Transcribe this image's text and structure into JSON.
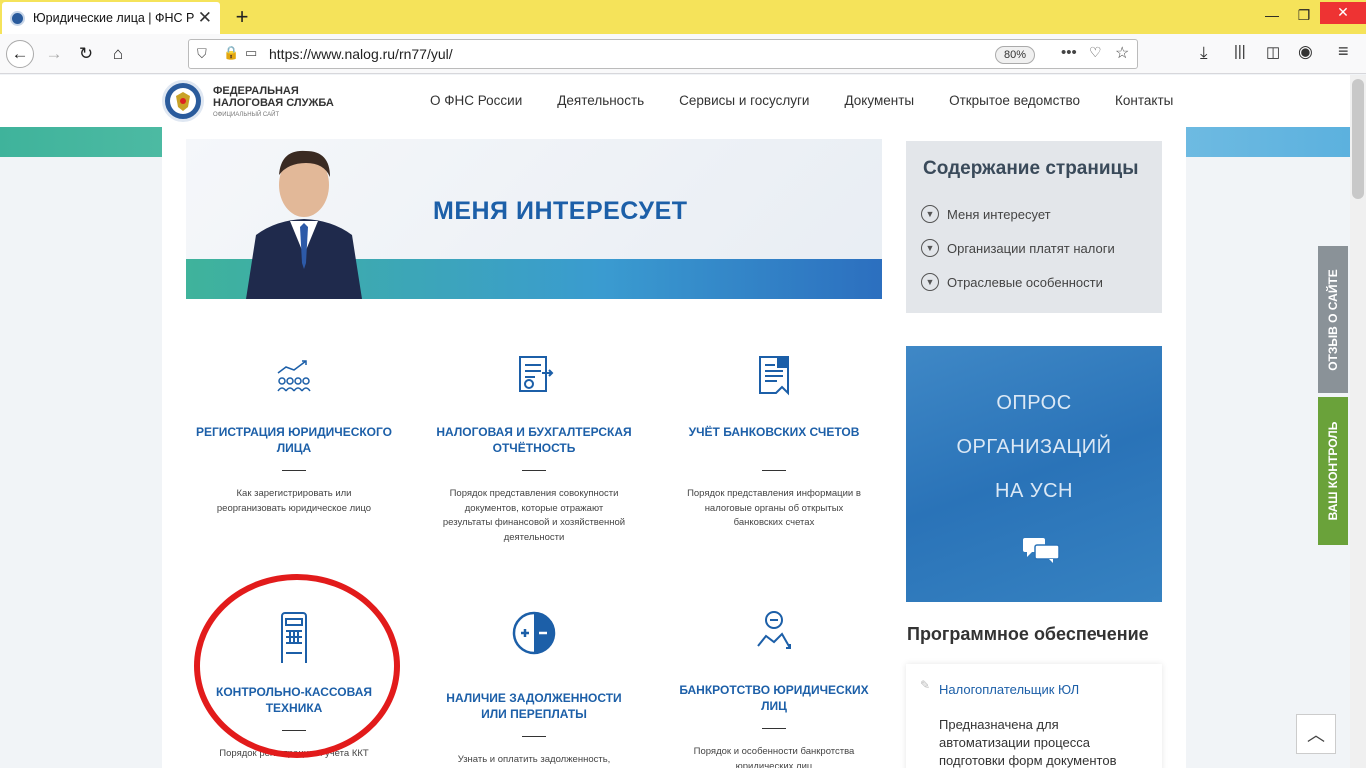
{
  "browser": {
    "tab_title": "Юридические лица | ФНС Рос",
    "url": "https://www.nalog.ru/rn77/yul/",
    "zoom": "80%"
  },
  "site": {
    "logo_line1": "ФЕДЕРАЛЬНАЯ",
    "logo_line2": "НАЛОГОВАЯ СЛУЖБА",
    "logo_sub": "ОФИЦИАЛЬНЫЙ САЙТ",
    "menu": [
      "О ФНС России",
      "Деятельность",
      "Сервисы и госуслуги",
      "Документы",
      "Открытое ведомство",
      "Контакты"
    ]
  },
  "hero": {
    "title": "МЕНЯ ИНТЕРЕСУЕТ"
  },
  "toc": {
    "title": "Содержание страницы",
    "items": [
      "Меня интересует",
      "Организации платят налоги",
      "Отраслевые особенности"
    ]
  },
  "cards": [
    {
      "icon": "people-growth-icon",
      "title": "РЕГИСТРАЦИЯ ЮРИДИЧЕСКОГО ЛИЦА",
      "desc": "Как зарегистрировать или реорганизовать юридическое лицо"
    },
    {
      "icon": "report-document-icon",
      "title": "НАЛОГОВАЯ И БУХГАЛТЕРСКАЯ ОТЧЁТНОСТЬ",
      "desc": "Порядок представления совокупности документов, которые отражают результаты финансовой и хозяйственной деятельности"
    },
    {
      "icon": "bank-document-icon",
      "title": "УЧЁТ БАНКОВСКИХ СЧЕТОВ",
      "desc": "Порядок представления информации в налоговые органы об открытых банковских счетах"
    },
    {
      "icon": "cash-register-icon",
      "title": "КОНТРОЛЬНО-КАССОВАЯ ТЕХНИКА",
      "desc": "Порядок регистрации и учета ККТ"
    },
    {
      "icon": "plus-minus-icon",
      "title": "НАЛИЧИЕ ЗАДОЛЖЕННОСТИ ИЛИ ПЕРЕПЛАТЫ",
      "desc": "Узнать и оплатить задолженность, вернуть излишне уплаченную сумму"
    },
    {
      "icon": "bankruptcy-icon",
      "title": "БАНКРОТСТВО ЮРИДИЧЕСКИХ ЛИЦ",
      "desc": "Порядок и особенности банкротства юридических лиц"
    }
  ],
  "survey": {
    "line1": "ОПРОС",
    "line2": "ОРГАНИЗАЦИЙ",
    "line3": "НА УСН"
  },
  "software": {
    "title": "Программное обеспечение",
    "item_name": "Налогоплательщик ЮЛ",
    "item_desc": "Предназначена для автоматизации процесса подготовки форм документов"
  },
  "side_tabs": {
    "feedback": "ОТЗЫВ О САЙТЕ",
    "control": "ВАШ КОНТРОЛЬ"
  },
  "colors": {
    "brand_blue": "#1c5fa8",
    "tab_bar": "#f5e35a",
    "highlight_circle": "#e21b1b"
  }
}
